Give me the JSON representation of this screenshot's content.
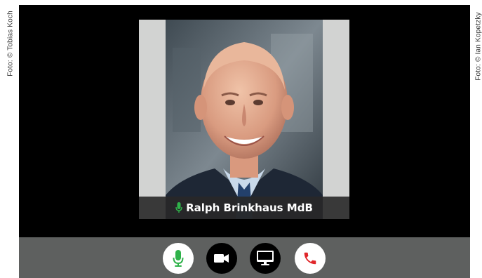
{
  "credits": {
    "left": "Foto: © Tobias Koch",
    "right": "Foto: © Ian Kopetzky"
  },
  "participant": {
    "name": "Ralph Brinkhaus MdB",
    "mic_status": "unmuted"
  },
  "controls": {
    "mic": {
      "icon": "microphone-icon",
      "color": "#2fb24a"
    },
    "camera": {
      "icon": "video-camera-icon"
    },
    "screen_share": {
      "icon": "monitor-icon"
    },
    "hang_up": {
      "icon": "phone-hangup-icon",
      "color": "#e0262a"
    }
  },
  "colors": {
    "tile_background": "#d2d3d2",
    "control_bar": "#5e605f",
    "mic_active": "#2fb24a",
    "hang_up": "#e0262a"
  }
}
